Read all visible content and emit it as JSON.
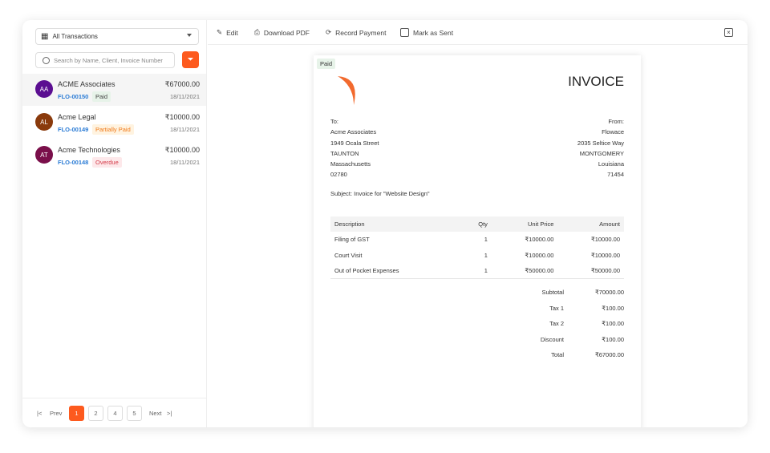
{
  "sidebar": {
    "filter": "All Transactions",
    "search_placeholder": "Search by Name, Client, Invoice Number",
    "items": [
      {
        "initials": "AA",
        "name": "ACME Associates",
        "amount": "₹67000.00",
        "id": "FLO-00150",
        "status": "Paid",
        "date": "18/11/2021",
        "avatar_color": "#5b0e91"
      },
      {
        "initials": "AL",
        "name": "Acme Legal",
        "amount": "₹10000.00",
        "id": "FLO-00149",
        "status": "Partially Paid",
        "date": "18/11/2021",
        "avatar_color": "#8a3a0c"
      },
      {
        "initials": "AT",
        "name": "Acme Technologies",
        "amount": "₹10000.00",
        "id": "FLO-00148",
        "status": "Overdue",
        "date": "18/11/2021",
        "avatar_color": "#7a0f4a"
      }
    ]
  },
  "pager": {
    "prev": "Prev",
    "next": "Next",
    "pages": [
      "1",
      "2",
      "4",
      "5"
    ],
    "current": "1"
  },
  "toolbar": {
    "edit": "Edit",
    "download": "Download PDF",
    "record": "Record Payment",
    "mark_sent": "Mark as Sent"
  },
  "invoice": {
    "status": "Paid",
    "title": "INVOICE",
    "to": {
      "label": "To:",
      "lines": [
        "Acme Associates",
        "1949 Ocala Street",
        "TAUNTON",
        "Massachusetts",
        "02780"
      ]
    },
    "from": {
      "label": "From:",
      "lines": [
        "Flowace",
        "2035 Seltice Way",
        "MONTGOMERY",
        "Louisiana",
        "71454"
      ]
    },
    "subject": "Subject: Invoice for \"Website Design\"",
    "headers": [
      "Description",
      "Qty",
      "Unit Price",
      "Amount"
    ],
    "rows": [
      [
        "Filing of GST",
        "1",
        "₹10000.00",
        "₹10000.00"
      ],
      [
        "Court Visit",
        "1",
        "₹10000.00",
        "₹10000.00"
      ],
      [
        "Out of Pocket Expenses",
        "1",
        "₹50000.00",
        "₹50000.00"
      ]
    ],
    "totals": [
      [
        "Subtotal",
        "₹70000.00"
      ],
      [
        "Tax 1",
        "₹100.00"
      ],
      [
        "Tax 2",
        "₹100.00"
      ],
      [
        "Discount",
        "₹100.00"
      ],
      [
        "Total",
        "₹67000.00"
      ]
    ]
  }
}
